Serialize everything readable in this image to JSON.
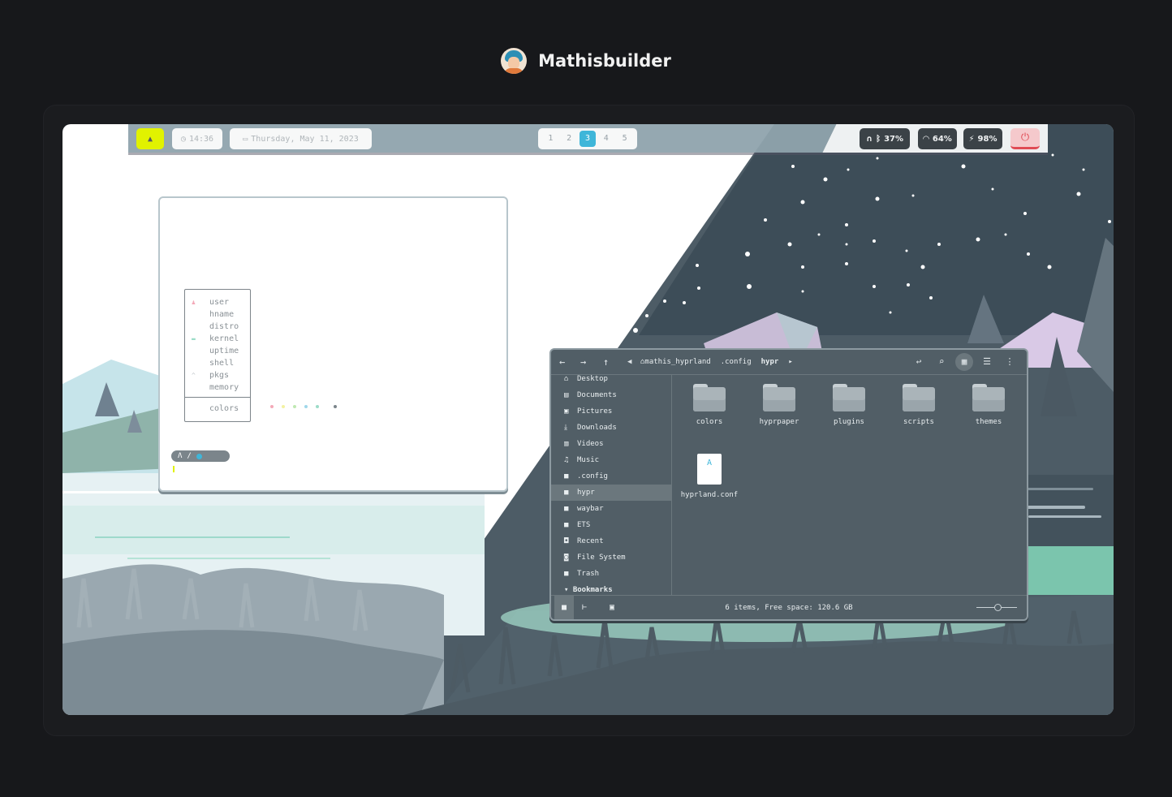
{
  "brand": {
    "name": "Mathisbuilder",
    "avatar_icon": "avatar-icon"
  },
  "topbar": {
    "launcher_icon": "arch-icon",
    "time": "14:36",
    "date": "Thursday, May 11, 2023",
    "workspaces": [
      "1",
      "2",
      "3",
      "4",
      "5"
    ],
    "active_workspace": "3",
    "bluetooth": "37%",
    "wifi": "64%",
    "battery": "98%",
    "power_icon": "power-icon"
  },
  "terminal": {
    "fetch_labels": [
      "user",
      "hname",
      "distro",
      "kernel",
      "uptime",
      "shell",
      "pkgs",
      "memory"
    ],
    "colors_label": "colors",
    "palette": [
      "#f4a9b8",
      "#f3f2a2",
      "#bfe8b2",
      "#9fd7ea",
      "#9cdcc8",
      "#7b858b"
    ]
  },
  "filemanager": {
    "breadcrumb": [
      "mathis_hyprland",
      ".config",
      "hypr"
    ],
    "sidebar": [
      {
        "label": "Desktop",
        "icon": "home-icon"
      },
      {
        "label": "Documents",
        "icon": "document-icon"
      },
      {
        "label": "Pictures",
        "icon": "image-icon"
      },
      {
        "label": "Downloads",
        "icon": "download-icon"
      },
      {
        "label": "Videos",
        "icon": "video-icon"
      },
      {
        "label": "Music",
        "icon": "music-icon"
      },
      {
        "label": ".config",
        "icon": "folder-icon"
      },
      {
        "label": "hypr",
        "icon": "folder-icon"
      },
      {
        "label": "waybar",
        "icon": "folder-icon"
      },
      {
        "label": "ETS",
        "icon": "folder-icon"
      },
      {
        "label": "Recent",
        "icon": "recent-icon"
      },
      {
        "label": "File System",
        "icon": "drive-icon"
      },
      {
        "label": "Trash",
        "icon": "trash-icon"
      }
    ],
    "bookmarks_label": "Bookmarks",
    "items": [
      {
        "name": "colors",
        "kind": "folder"
      },
      {
        "name": "hyprpaper",
        "kind": "folder"
      },
      {
        "name": "plugins",
        "kind": "folder"
      },
      {
        "name": "scripts",
        "kind": "folder"
      },
      {
        "name": "themes",
        "kind": "folder"
      },
      {
        "name": "hyprland.conf",
        "kind": "file"
      }
    ],
    "status": "6 items, Free space: 120.6 GB"
  },
  "colors": {
    "accent": "#3fb6d9",
    "launcher": "#e1f200",
    "power": "#e04b55"
  }
}
